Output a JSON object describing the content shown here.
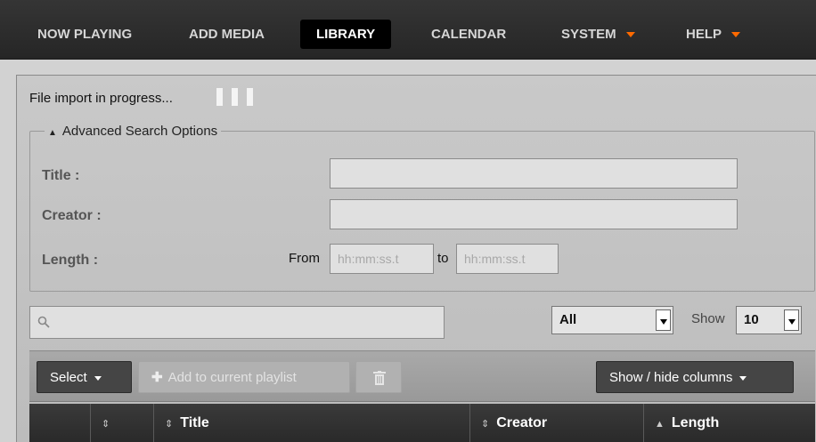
{
  "nav": {
    "items": [
      {
        "label": "NOW PLAYING"
      },
      {
        "label": "ADD MEDIA"
      },
      {
        "label": "LIBRARY"
      },
      {
        "label": "CALENDAR"
      },
      {
        "label": "SYSTEM"
      },
      {
        "label": "HELP"
      }
    ],
    "active": "LIBRARY",
    "accent_color": "#ff6a00"
  },
  "status": {
    "import_progress": "File import in progress..."
  },
  "advanced_search": {
    "legend": "Advanced Search Options",
    "title_label": "Title :",
    "creator_label": "Creator :",
    "length_label": "Length :",
    "from_label": "From",
    "to_label": "to",
    "from_placeholder": "hh:mm:ss.t",
    "to_placeholder": "hh:mm:ss.t",
    "title_value": "",
    "creator_value": ""
  },
  "filter": {
    "search_value": "",
    "type_selected": "All",
    "show_label": "Show",
    "page_size": "10"
  },
  "toolbar": {
    "select_label": "Select",
    "add_label": "Add to current playlist",
    "columns_label": "Show / hide columns"
  },
  "table": {
    "columns": [
      {
        "label": ""
      },
      {
        "label": ""
      },
      {
        "label": "Title"
      },
      {
        "label": "Creator"
      },
      {
        "label": "Length"
      }
    ]
  }
}
